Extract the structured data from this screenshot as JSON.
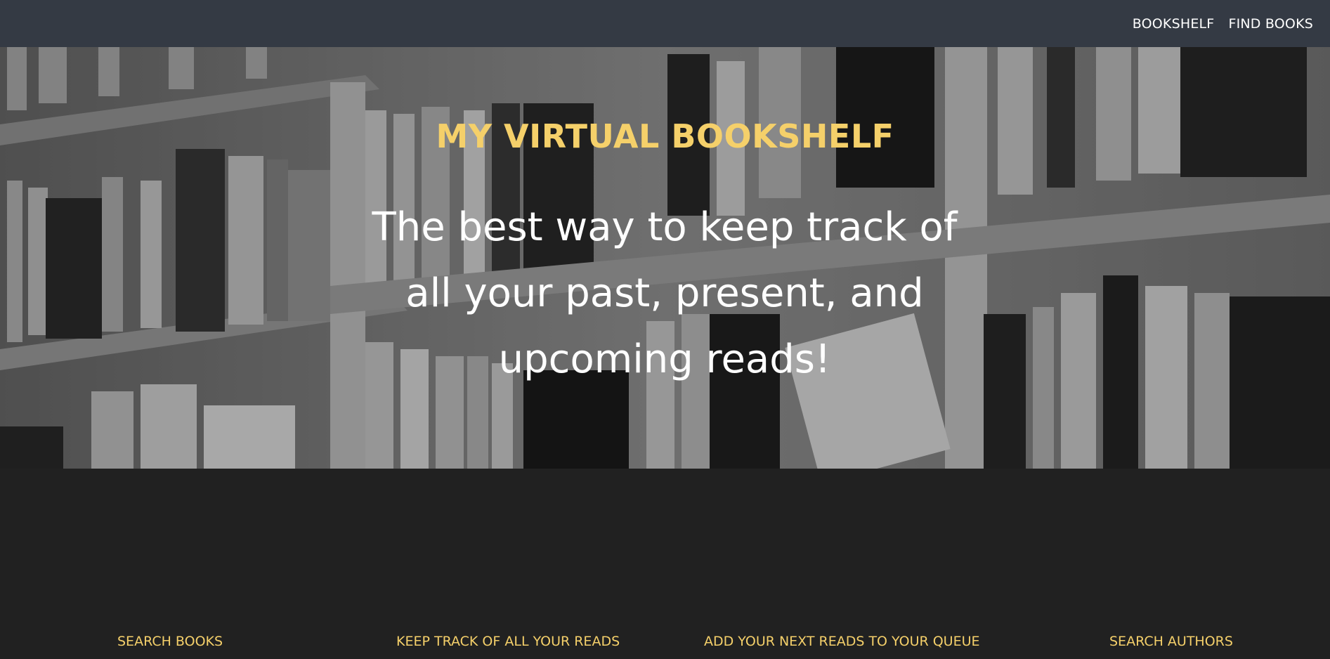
{
  "nav": {
    "links": [
      "BOOKSHELF",
      "FIND BOOKS"
    ]
  },
  "hero": {
    "title": "MY VIRTUAL BOOKSHELF",
    "tagline": "The best way to keep track of all your past, present, and upcoming reads!",
    "background_description_icon": "bookshelf-photo"
  },
  "features": {
    "items": [
      "SEARCH BOOKS",
      "KEEP TRACK OF ALL YOUR READS",
      "ADD YOUR NEXT READS TO YOUR QUEUE",
      "SEARCH AUTHORS"
    ]
  },
  "colors": {
    "navbar": "#343a44",
    "accent": "#f5d06a",
    "body": "#212121"
  }
}
